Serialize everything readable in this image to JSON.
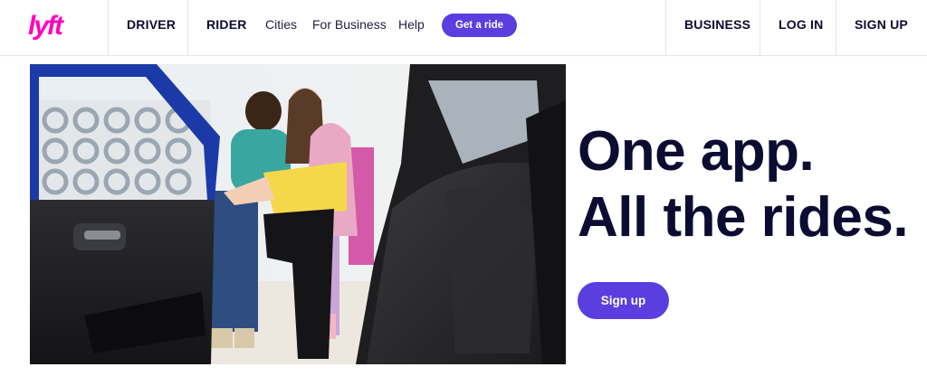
{
  "header": {
    "logo": {
      "text": "lyft",
      "color": "#ff00bf"
    },
    "nav_left": [
      {
        "label": "DRIVER"
      },
      {
        "label": "RIDER"
      },
      {
        "label": "Cities"
      },
      {
        "label": "For Business"
      },
      {
        "label": "Help"
      }
    ],
    "cta_label": "Get a ride",
    "nav_right": [
      {
        "label": "BUSINESS"
      },
      {
        "label": "LOG IN"
      },
      {
        "label": "SIGN UP"
      }
    ]
  },
  "hero": {
    "headline_line1": "One app.",
    "headline_line2": "All the rides.",
    "signup_label": "Sign up"
  },
  "colors": {
    "brand_pink": "#ff00bf",
    "accent_purple": "#5a3ee0",
    "text_navy": "#0c0b31"
  }
}
